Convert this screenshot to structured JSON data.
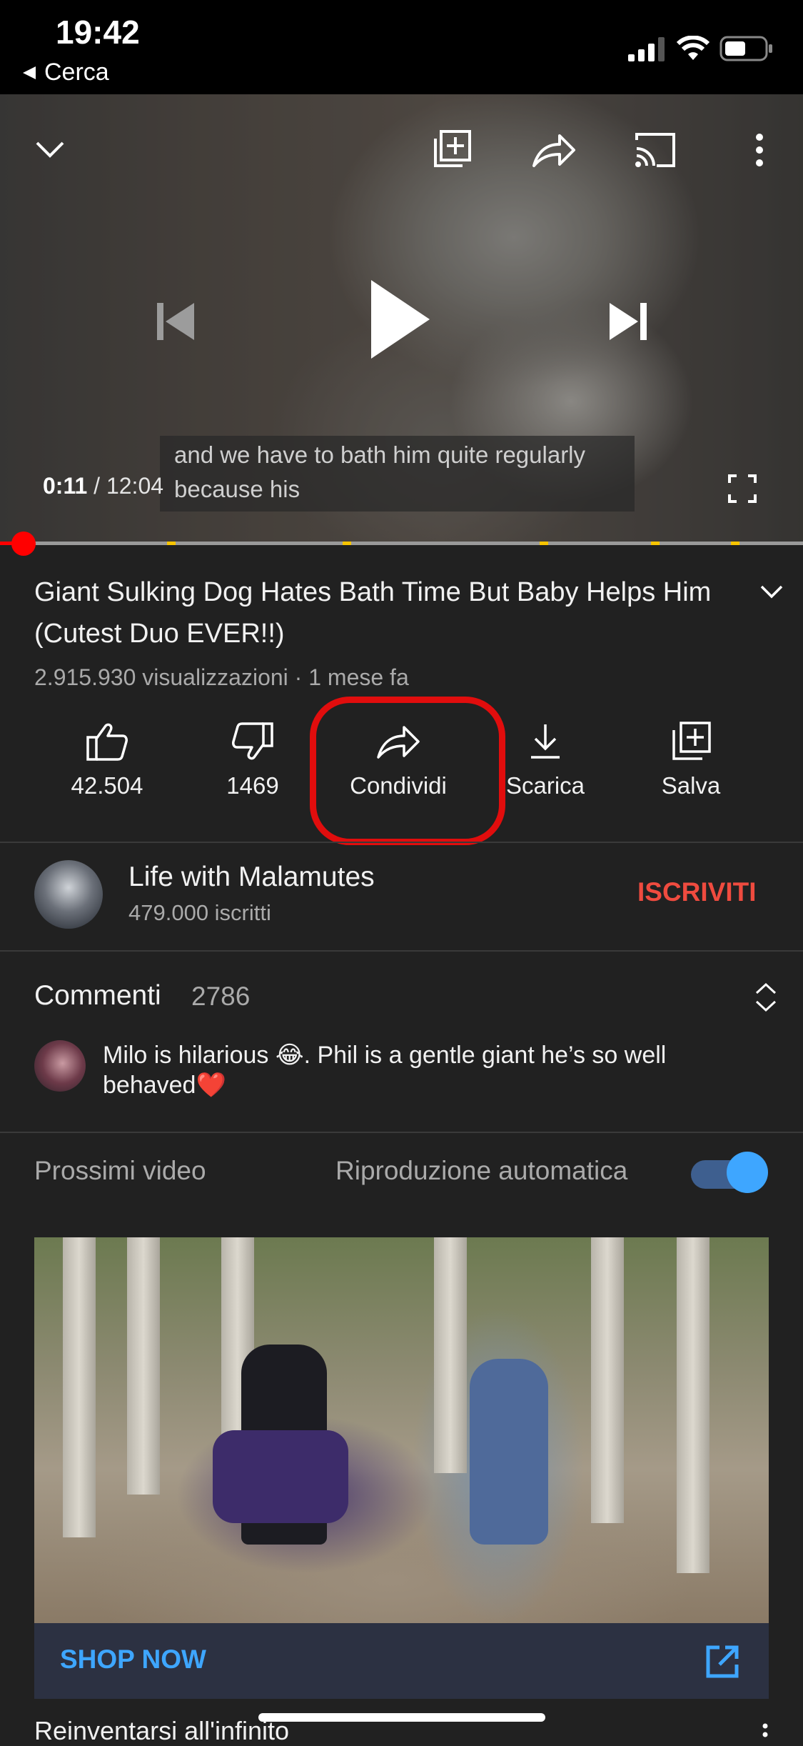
{
  "status_bar": {
    "time": "19:42",
    "back_label": "Cerca"
  },
  "player": {
    "caption_line1": "and we have to bath him quite regularly",
    "caption_line2": "because his",
    "current_time": "0:11",
    "duration": "/ 12:04",
    "progress_fraction": 0.009
  },
  "video": {
    "title": "Giant Sulking Dog Hates Bath Time But Baby Helps Him (Cutest Duo EVER!!)",
    "meta": "2.915.930 visualizzazioni · 1 mese fa"
  },
  "actions": {
    "like": "42.504",
    "dislike": "1469",
    "share": "Condividi",
    "download": "Scarica",
    "save": "Salva"
  },
  "channel": {
    "name": "Life with Malamutes",
    "subscribers": "479.000 iscritti",
    "subscribe_label": "ISCRIVITI"
  },
  "comments": {
    "title": "Commenti",
    "count": "2786",
    "top_comment": "Milo is hilarious 😂. Phil is a gentle giant he’s so well behaved❤️"
  },
  "up_next": {
    "title": "Prossimi video",
    "autoplay_label": "Riproduzione automatica",
    "autoplay_on": true
  },
  "ad": {
    "cta": "SHOP NOW",
    "next_title": "Reinventarsi all'infinito"
  },
  "colors": {
    "accent_red": "#ff0000",
    "subscribe_red": "#ef4b3f",
    "link_blue": "#3ea6ff",
    "background": "#212121"
  }
}
